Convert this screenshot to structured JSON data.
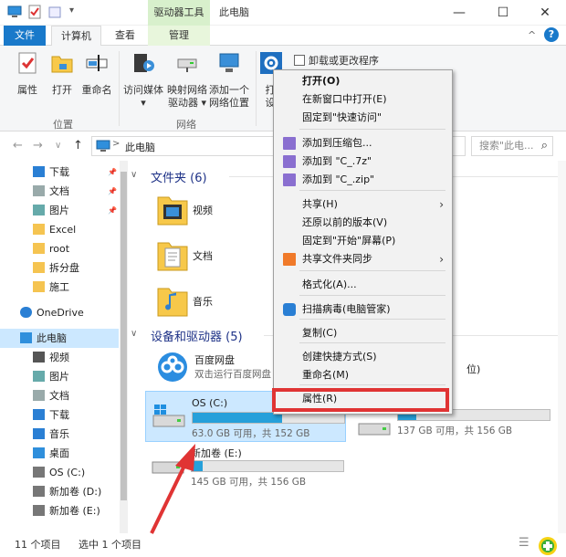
{
  "titlebar": {
    "context_tab_header": "驱动器工具",
    "window_title": "此电脑",
    "minimize": "—",
    "maximize": "☐",
    "close": "✕"
  },
  "ribbon_tabs": {
    "file": "文件",
    "computer": "计算机",
    "view": "查看",
    "manage": "管理",
    "collapse_caret": "^",
    "help": "?"
  },
  "ribbon": {
    "location_group": {
      "label": "位置",
      "buttons": [
        "属性",
        "打开",
        "重命名"
      ]
    },
    "network_group": {
      "label": "网络",
      "media": [
        "访问媒体",
        "▾"
      ],
      "map_drive": [
        "映射网络",
        "驱动器 ▾"
      ],
      "add_location": [
        "添加一个",
        "网络位置"
      ]
    },
    "system_group": {
      "first_letter": "打",
      "second_letter": "设",
      "uninstall": "卸载或更改程序"
    }
  },
  "address": {
    "back": "←",
    "forward": "→",
    "recent": "∨",
    "up": "↑",
    "path": "此电脑",
    "path_separator": ">",
    "search_placeholder": "搜索\"此电... ",
    "search_icon": "⌕"
  },
  "nav": {
    "items": [
      {
        "label": "下载",
        "pinned": true
      },
      {
        "label": "文档",
        "pinned": true
      },
      {
        "label": "图片",
        "pinned": true
      },
      {
        "label": "Excel",
        "pinned": false
      },
      {
        "label": "root",
        "pinned": false
      },
      {
        "label": "拆分盘",
        "pinned": false
      },
      {
        "label": "施工",
        "pinned": false
      },
      {
        "label": "OneDrive",
        "pinned": false
      },
      {
        "label": "此电脑",
        "pinned": false
      },
      {
        "label": "视频",
        "pinned": false
      },
      {
        "label": "图片",
        "pinned": false
      },
      {
        "label": "文档",
        "pinned": false
      },
      {
        "label": "下载",
        "pinned": false
      },
      {
        "label": "音乐",
        "pinned": false
      },
      {
        "label": "桌面",
        "pinned": false
      },
      {
        "label": "OS (C:)",
        "pinned": false
      },
      {
        "label": "新加卷 (D:)",
        "pinned": false
      },
      {
        "label": "新加卷 (E:)",
        "pinned": false
      }
    ]
  },
  "main": {
    "folders_header": "文件夹 (6)",
    "folders": [
      "视频",
      "文档",
      "音乐"
    ],
    "devices_header": "设备和驱动器 (5)",
    "netdisk": {
      "name": "百度网盘",
      "sub": "双击运行百度网盘"
    },
    "drives": [
      {
        "name": "OS (C:)",
        "free_text": "63.0 GB 可用，共 152 GB",
        "used_fraction": 0.59
      },
      {
        "name": "新加卷 (E:)",
        "free_text": "145 GB 可用，共 156 GB",
        "used_fraction": 0.07
      },
      {
        "name": "位)",
        "free_text": "137 GB 可用，共 156 GB",
        "used_fraction": 0.12
      }
    ],
    "partial_item": "位)",
    "partial_drive_text": "137 GB 可用，共 156 GB"
  },
  "context_menu": {
    "items": [
      {
        "label": "打开(O)",
        "bold": true
      },
      {
        "label": "在新窗口中打开(E)"
      },
      {
        "label": "固定到\"快速访问\""
      },
      {
        "label": "添加到压缩包..."
      },
      {
        "label": "添加到 \"C_.7z\""
      },
      {
        "label": "添加到 \"C_.zip\""
      },
      {
        "label": "共享(H)",
        "submenu": true
      },
      {
        "label": "还原以前的版本(V)"
      },
      {
        "label": "固定到\"开始\"屏幕(P)"
      },
      {
        "label": "共享文件夹同步",
        "submenu": true
      },
      {
        "label": "格式化(A)..."
      },
      {
        "label": "扫描病毒(电脑管家)"
      },
      {
        "label": "复制(C)"
      },
      {
        "label": "创建快捷方式(S)"
      },
      {
        "label": "重命名(M)"
      },
      {
        "label": "属性(R)"
      }
    ],
    "submenu_arrow": "›"
  },
  "statusbar": {
    "count": "11 个项目",
    "selected": "选中 1 个项目"
  },
  "colors": {
    "accent": "#1979ca",
    "selection": "#cce8ff",
    "drive_bar": "#26a0da",
    "highlight_box": "#e03434",
    "annotation_arrow": "#e03434"
  }
}
